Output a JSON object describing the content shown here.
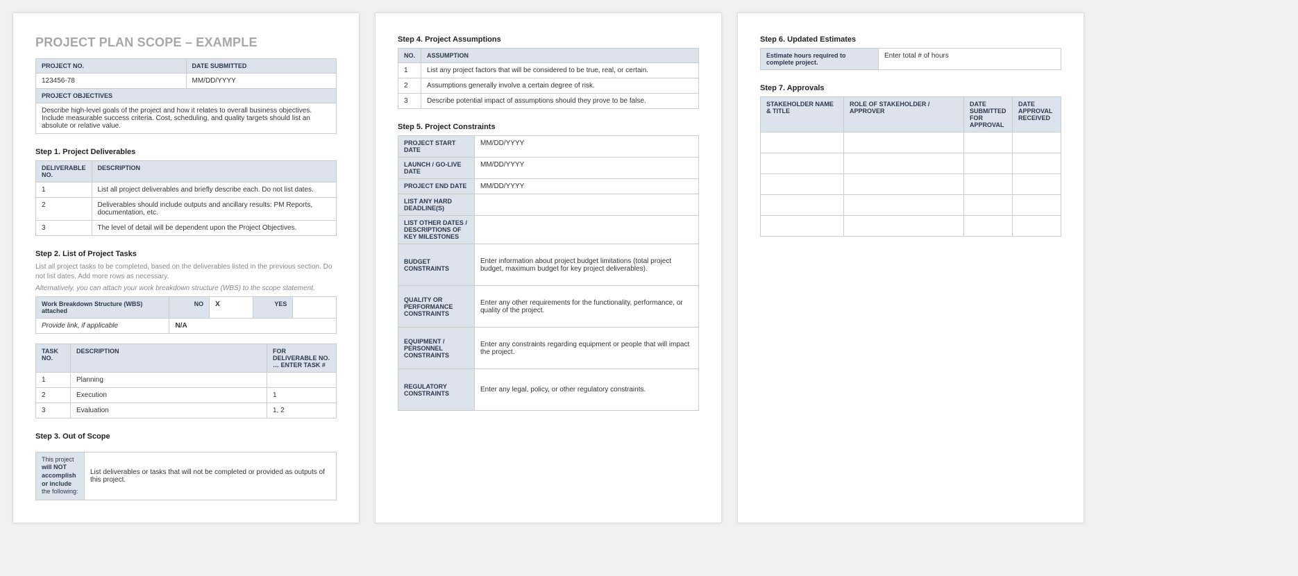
{
  "docTitle": "PROJECT PLAN SCOPE – EXAMPLE",
  "projectInfo": {
    "projectNoLabel": "PROJECT NO.",
    "projectNoValue": "123456-78",
    "dateSubmittedLabel": "DATE SUBMITTED",
    "dateSubmittedValue": "MM/DD/YYYY",
    "objectivesLabel": "PROJECT OBJECTIVES",
    "objectivesText": "Describe high-level goals of the project and how it relates to overall business objectives.  Include measurable success criteria.  Cost, scheduling, and quality targets should list an absolute or relative value."
  },
  "step1": {
    "title": "Step 1. Project Deliverables",
    "headers": {
      "no": "DELIVERABLE NO.",
      "desc": "DESCRIPTION"
    },
    "rows": [
      {
        "no": "1",
        "desc": "List all project deliverables and briefly describe each. Do not list dates."
      },
      {
        "no": "2",
        "desc": "Deliverables should include outputs and ancillary results: PM Reports, documentation, etc."
      },
      {
        "no": "3",
        "desc": "The level of detail will be dependent upon the Project Objectives."
      }
    ]
  },
  "step2": {
    "title": "Step 2. List of Project Tasks",
    "sub1": "List all project tasks to be completed, based on the deliverables listed in the previous section. Do not list dates. Add more rows as necessary.",
    "sub2": "Alternatively, you can attach your work breakdown structure (WBS) to the scope statement.",
    "wbs": {
      "attachedLabel": "Work Breakdown Structure (WBS) attached",
      "noLabel": "NO",
      "noVal": "X",
      "yesLabel": "YES",
      "yesVal": "",
      "provideLink": "Provide link, if applicable",
      "na": "N/A"
    },
    "taskHeaders": {
      "no": "TASK NO.",
      "desc": "DESCRIPTION",
      "forDeliv": "FOR DELIVERABLE NO. … ENTER TASK #"
    },
    "taskRows": [
      {
        "no": "1",
        "desc": "Planning",
        "forDeliv": ""
      },
      {
        "no": "2",
        "desc": "Execution",
        "forDeliv": "1"
      },
      {
        "no": "3",
        "desc": "Evaluation",
        "forDeliv": "1, 2"
      }
    ]
  },
  "step3": {
    "title": "Step 3. Out of Scope",
    "labelPre": "This project ",
    "labelBold": "will NOT accomplish or include",
    "labelPost": " the following:",
    "text": "List deliverables or tasks that will not be completed or provided as outputs of this project."
  },
  "step4": {
    "title": "Step 4. Project Assumptions",
    "headers": {
      "no": "NO.",
      "assumption": "ASSUMPTION"
    },
    "rows": [
      {
        "no": "1",
        "text": "List any project factors that will be considered to be true, real, or certain."
      },
      {
        "no": "2",
        "text": "Assumptions generally involve a certain degree of risk."
      },
      {
        "no": "3",
        "text": "Describe potential impact of assumptions should they prove to be false."
      }
    ]
  },
  "step5": {
    "title": "Step 5. Project Constraints",
    "rows": {
      "startLabel": "PROJECT START DATE",
      "startVal": "MM/DD/YYYY",
      "launchLabel": "LAUNCH / GO-LIVE DATE",
      "launchVal": "MM/DD/YYYY",
      "endLabel": "PROJECT END DATE",
      "endVal": "MM/DD/YYYY",
      "hardLabel": "LIST ANY HARD DEADLINE(S)",
      "hardVal": "",
      "otherLabel": "LIST OTHER DATES / DESCRIPTIONS OF KEY MILESTONES",
      "otherVal": "",
      "budgetLabel": "BUDGET CONSTRAINTS",
      "budgetVal": "Enter information about project budget limitations (total project budget, maximum budget for key project deliverables).",
      "qualityLabel": "QUALITY OR PERFORMANCE CONSTRAINTS",
      "qualityVal": "Enter any other requirements for the functionality, performance, or quality of the project.",
      "equipLabel": "EQUIPMENT / PERSONNEL CONSTRAINTS",
      "equipVal": "Enter any constraints regarding equipment or people that will impact the project.",
      "regLabel": "REGULATORY CONSTRAINTS",
      "regVal": "Enter any legal, policy, or other regulatory constraints."
    }
  },
  "step6": {
    "title": "Step 6. Updated Estimates",
    "label": "Estimate hours required to complete project.",
    "value": "Enter total # of hours"
  },
  "step7": {
    "title": "Step 7. Approvals",
    "headers": {
      "name": "STAKEHOLDER NAME & TITLE",
      "role": "ROLE OF STAKEHOLDER / APPROVER",
      "dateSubmitted": "DATE SUBMITTED FOR APPROVAL",
      "dateReceived": "DATE APPROVAL RECEIVED"
    }
  }
}
